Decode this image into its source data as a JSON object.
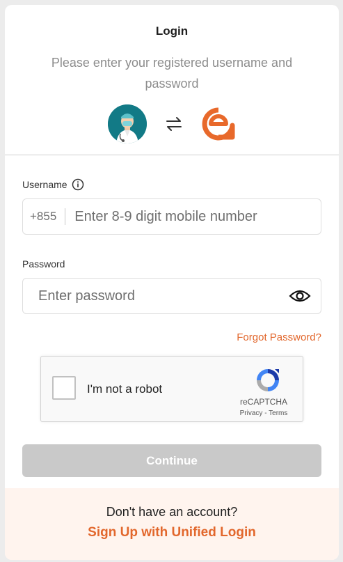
{
  "header": {
    "title": "Login",
    "subtitle": "Please enter your registered username and password",
    "avatar_icon": "doctor-avatar-icon",
    "swap_icon": "swap-arrows-icon",
    "brand_icon": "brand-logo-icon"
  },
  "username": {
    "label": "Username",
    "info_icon": "info-icon",
    "prefix": "+855",
    "placeholder": "Enter 8-9 digit mobile number",
    "value": ""
  },
  "password": {
    "label": "Password",
    "placeholder": "Enter password",
    "value": "",
    "toggle_icon": "eye-icon"
  },
  "forgot_password": "Forgot Password?",
  "captcha": {
    "label": "I'm not a robot",
    "brand": "reCAPTCHA",
    "links": "Privacy - Terms"
  },
  "continue_label": "Continue",
  "footer": {
    "question": "Don't have an account?",
    "signup_label": "Sign Up with Unified Login"
  },
  "colors": {
    "accent": "#e2672c",
    "avatar_bg": "#127a86",
    "button_disabled": "#c9c9c9",
    "footer_bg": "#fff4ee"
  }
}
